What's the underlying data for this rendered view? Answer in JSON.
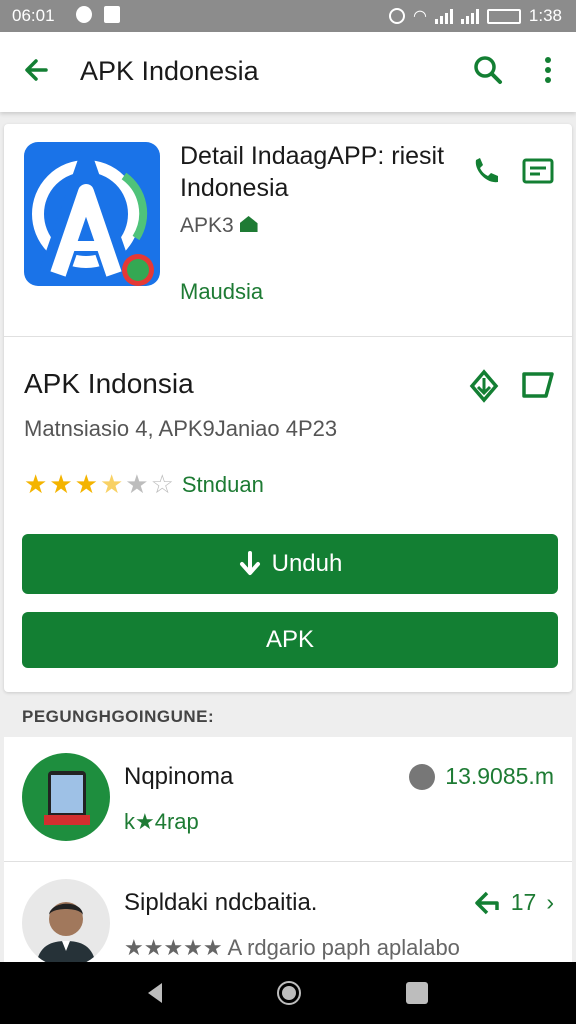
{
  "status_bar": {
    "time": "06:01",
    "battery": "1:38"
  },
  "app_bar": {
    "title": "APK Indonesia"
  },
  "app": {
    "name": "Detail IndaagAPP: riesit Indonesia",
    "developer": "APK3",
    "category": "Maudsia"
  },
  "section": {
    "title": "APK Indonsia",
    "subtitle": "Matnsiasio 4, APK9Janiao 4P23",
    "rating": 3.5,
    "rating_label": "Stnduan"
  },
  "buttons": {
    "download": "Unduh",
    "apk": "APK"
  },
  "list": {
    "header": "PEGUNGHGOINGUNE:",
    "items": [
      {
        "title": "Nqpinoma",
        "subtitle": "k★4rap",
        "meta": "13.9085.m"
      },
      {
        "title": "Sipldaki ndcbaitia.",
        "subtitle": "★★★★★ A rdgario paph aplalabo",
        "meta": "17"
      }
    ]
  },
  "colors": {
    "accent": "#137f33",
    "icon_bg": "#1a73e8",
    "star": "#f4b400"
  }
}
